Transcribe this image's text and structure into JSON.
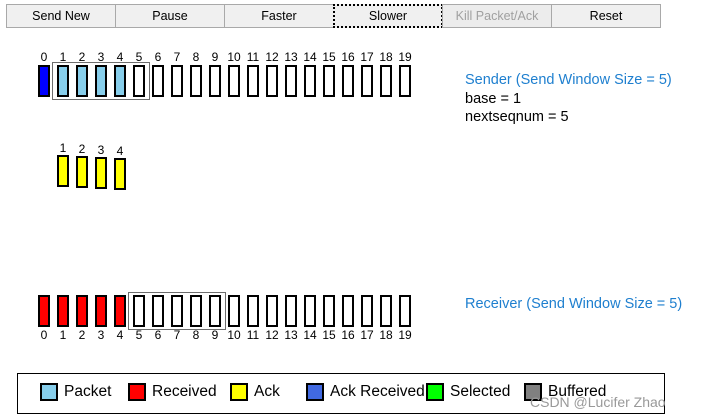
{
  "toolbar": {
    "send_new": "Send New",
    "pause": "Pause",
    "faster": "Faster",
    "slower": "Slower",
    "kill": "Kill Packet/Ack",
    "reset": "Reset"
  },
  "seq_numbers": [
    "0",
    "1",
    "2",
    "3",
    "4",
    "5",
    "6",
    "7",
    "8",
    "9",
    "10",
    "11",
    "12",
    "13",
    "14",
    "15",
    "16",
    "17",
    "18",
    "19"
  ],
  "sender": {
    "title": "Sender (Send Window Size = 5)",
    "base": "base = 1",
    "nextseqnum": "nextseqnum = 5",
    "window_start": 1,
    "window_size": 5,
    "states": [
      "ack_received",
      "packet",
      "packet",
      "packet",
      "packet",
      "empty",
      "empty",
      "empty",
      "empty",
      "empty",
      "empty",
      "empty",
      "empty",
      "empty",
      "empty",
      "empty",
      "empty",
      "empty",
      "empty",
      "empty"
    ]
  },
  "acks_in_flight": {
    "labels": [
      "1",
      "2",
      "3",
      "4"
    ],
    "color": "#ffff00"
  },
  "receiver": {
    "title": "Receiver (Send Window Size = 5)",
    "window_start": 5,
    "window_size": 5,
    "states": [
      "received",
      "received",
      "received",
      "received",
      "received",
      "empty",
      "empty",
      "empty",
      "empty",
      "empty",
      "empty",
      "empty",
      "empty",
      "empty",
      "empty",
      "empty",
      "empty",
      "empty",
      "empty",
      "empty"
    ]
  },
  "colors": {
    "packet": "#87ceeb",
    "received": "#ff0000",
    "ack": "#ffff00",
    "ack_received": "#0000ff",
    "selected": "#00ff00",
    "buffered": "#808080",
    "empty": "#ffffff",
    "info_title": "#1e7fcf"
  },
  "legend": [
    {
      "label": "Packet",
      "color": "#87ceeb"
    },
    {
      "label": "Received",
      "color": "#ff0000"
    },
    {
      "label": "Ack",
      "color": "#ffff00"
    },
    {
      "label": "Ack Received",
      "color": "#4169e1"
    },
    {
      "label": "Selected",
      "color": "#00ff00"
    },
    {
      "label": "Buffered",
      "color": "#808080"
    }
  ],
  "watermark": "CSDN @Lucifer Zhao"
}
